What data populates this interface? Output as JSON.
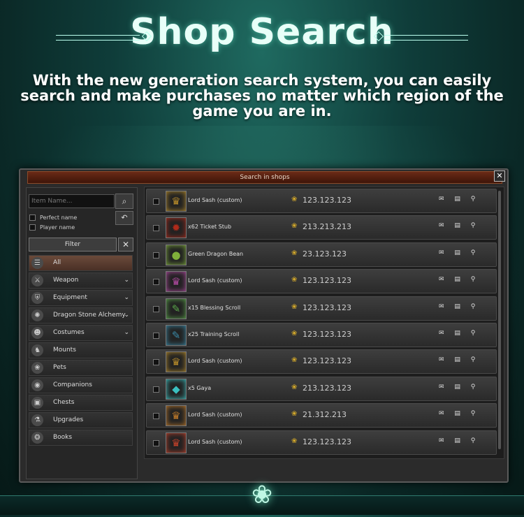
{
  "header": {
    "title": "Shop Search",
    "subtitle": "With the new generation search system, you can easily search and make purchases no matter which region of the game you are in."
  },
  "window": {
    "title": "Search in shops",
    "close": "✕"
  },
  "filters": {
    "search_placeholder": "Item Name...",
    "search_icon": "⌕",
    "back_icon": "↶",
    "perfect_name": "Perfect name",
    "player_name": "Player name",
    "filter_label": "Filter",
    "clear_icon": "✕"
  },
  "categories": [
    {
      "label": "All",
      "icon": "list-icon",
      "glyph": "☰",
      "active": true,
      "expandable": false
    },
    {
      "label": "Weapon",
      "icon": "sword-icon",
      "glyph": "⚔",
      "active": false,
      "expandable": true
    },
    {
      "label": "Equipment",
      "icon": "armor-icon",
      "glyph": "⛨",
      "active": false,
      "expandable": true
    },
    {
      "label": "Dragon Stone Alchemy",
      "icon": "stone-icon",
      "glyph": "✺",
      "active": false,
      "expandable": true
    },
    {
      "label": "Costumes",
      "icon": "mask-icon",
      "glyph": "☻",
      "active": false,
      "expandable": true
    },
    {
      "label": "Mounts",
      "icon": "horse-icon",
      "glyph": "♞",
      "active": false,
      "expandable": false
    },
    {
      "label": "Pets",
      "icon": "paw-icon",
      "glyph": "❀",
      "active": false,
      "expandable": false
    },
    {
      "label": "Companions",
      "icon": "companion-icon",
      "glyph": "◉",
      "active": false,
      "expandable": false
    },
    {
      "label": "Chests",
      "icon": "chest-icon",
      "glyph": "▣",
      "active": false,
      "expandable": false
    },
    {
      "label": "Upgrades",
      "icon": "potion-icon",
      "glyph": "⚗",
      "active": false,
      "expandable": false
    },
    {
      "label": "Books",
      "icon": "book-icon",
      "glyph": "❂",
      "active": false,
      "expandable": false
    }
  ],
  "chevron": "⌄",
  "results": [
    {
      "name": "Lord Sash (custom)",
      "price": "123.123.123",
      "icon": "sash-icon",
      "glyph": "♛",
      "color": "#b58a2a"
    },
    {
      "name": "x62 Ticket Stub",
      "price": "213.213.213",
      "icon": "ticket-icon",
      "glyph": "✹",
      "color": "#b02a1a"
    },
    {
      "name": "Green Dragon Bean",
      "price": "23.123.123",
      "icon": "bean-icon",
      "glyph": "●",
      "color": "#7fae3a"
    },
    {
      "name": "Lord Sash (custom)",
      "price": "123.123.123",
      "icon": "sash-icon",
      "glyph": "♛",
      "color": "#b04aa0"
    },
    {
      "name": "x15 Blessing Scroll",
      "price": "123.123.123",
      "icon": "scroll-icon",
      "glyph": "✎",
      "color": "#5aa84a"
    },
    {
      "name": "x25 Training Scroll",
      "price": "123.123.123",
      "icon": "scroll-icon",
      "glyph": "✎",
      "color": "#3a8aa8"
    },
    {
      "name": "Lord Sash (custom)",
      "price": "123.123.123",
      "icon": "sash-icon",
      "glyph": "♛",
      "color": "#b58a2a"
    },
    {
      "name": "x5 Gaya",
      "price": "213.123.123",
      "icon": "gem-icon",
      "glyph": "◆",
      "color": "#3ac0c0"
    },
    {
      "name": "Lord Sash (custom)",
      "price": "21.312.213",
      "icon": "sash-icon",
      "glyph": "♛",
      "color": "#c07a2a"
    },
    {
      "name": "Lord Sash (custom)",
      "price": "123.123.123",
      "icon": "sash-icon",
      "glyph": "♛",
      "color": "#c0402a"
    }
  ],
  "row_actions": "✉ ▤ ⚲",
  "coin_glyph": "❀"
}
